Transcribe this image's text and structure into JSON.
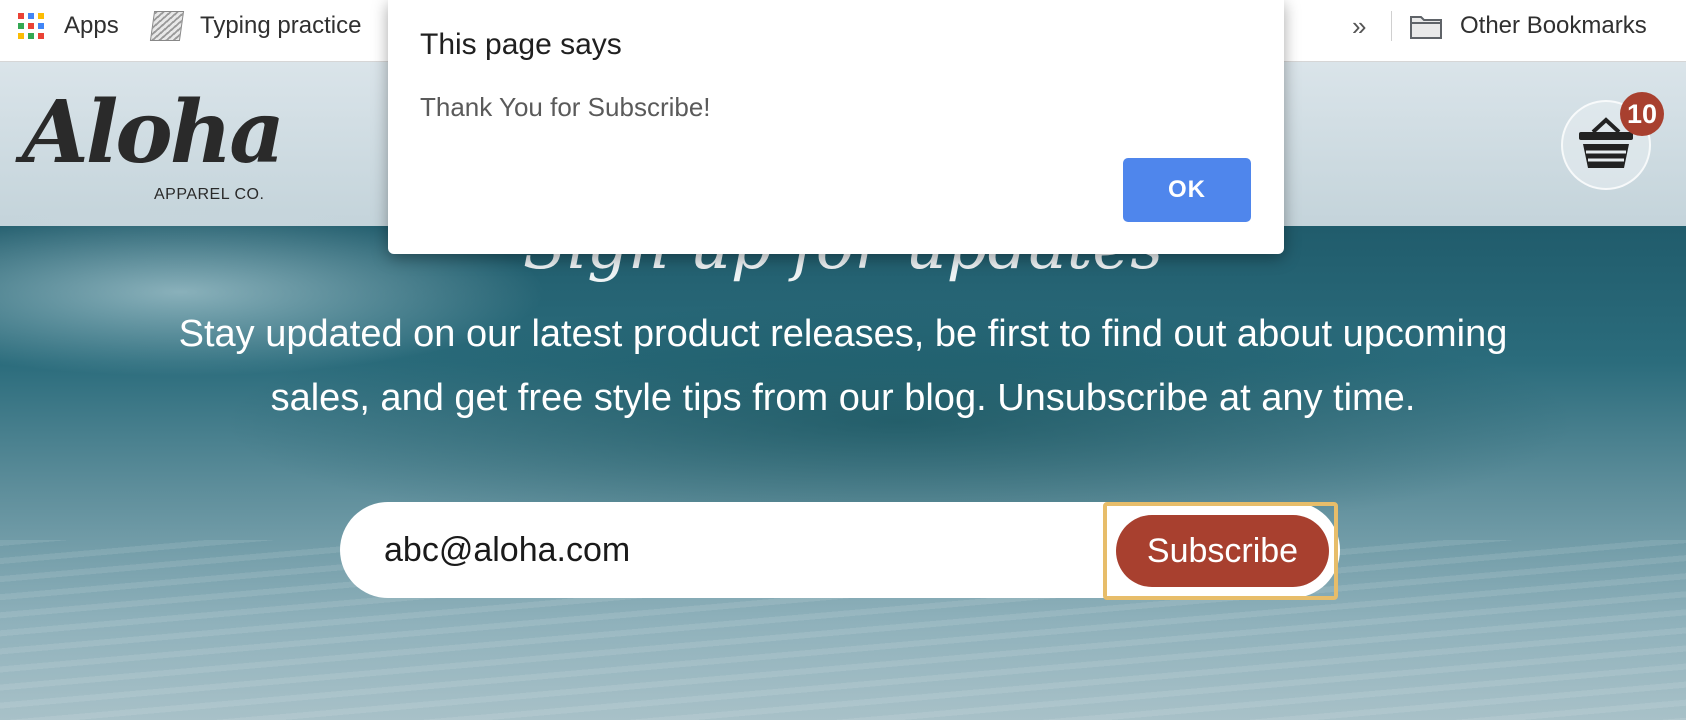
{
  "bookmarks": {
    "apps_label": "Apps",
    "typing_label": "Typing practice",
    "overflow_label": "»",
    "other_label": "Other Bookmarks"
  },
  "header": {
    "logo_text": "Aloha",
    "logo_subtext": "APPAREL CO.",
    "cart_count": "10"
  },
  "signup": {
    "title": "Sign up for updates",
    "text": "Stay updated on our latest product releases, be first to find out about upcoming sales, and get free style tips from our blog. Unsubscribe at any time.",
    "email_value": "abc@aloha.com",
    "subscribe_label": "Subscribe"
  },
  "dialog": {
    "title": "This page says",
    "message": "Thank You for Subscribe!",
    "ok_label": "OK"
  },
  "colors": {
    "accent_red": "#a8402f",
    "dialog_button": "#4f86ec",
    "focus_ring": "#e7bd6a"
  }
}
